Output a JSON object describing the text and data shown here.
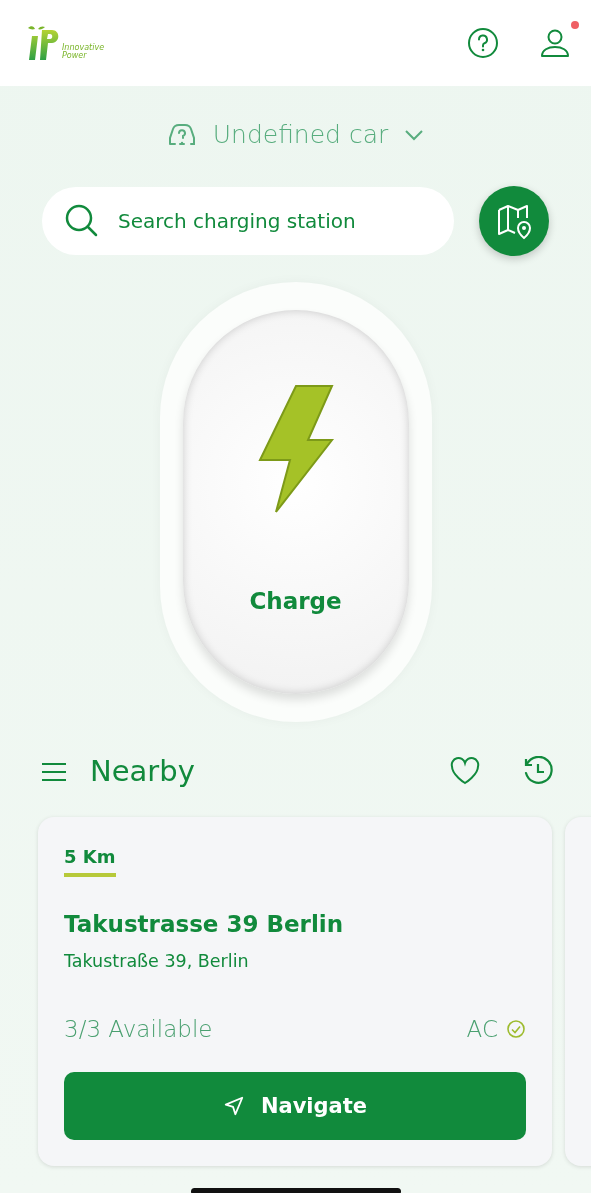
{
  "header": {
    "logo_text": "Innovative Power",
    "profile_notification": true
  },
  "car_selector": {
    "label": "Undefined car"
  },
  "search": {
    "placeholder": "Search charging station"
  },
  "charge_button": {
    "label": "Charge"
  },
  "nearby": {
    "title": "Nearby"
  },
  "stations": [
    {
      "distance": "5 Km",
      "name": "Takustrasse 39 Berlin",
      "address": "Takustraße 39, Berlin",
      "availability": "3/3 Available",
      "connector": "AC",
      "connector_available": true,
      "action": "Navigate"
    }
  ]
}
